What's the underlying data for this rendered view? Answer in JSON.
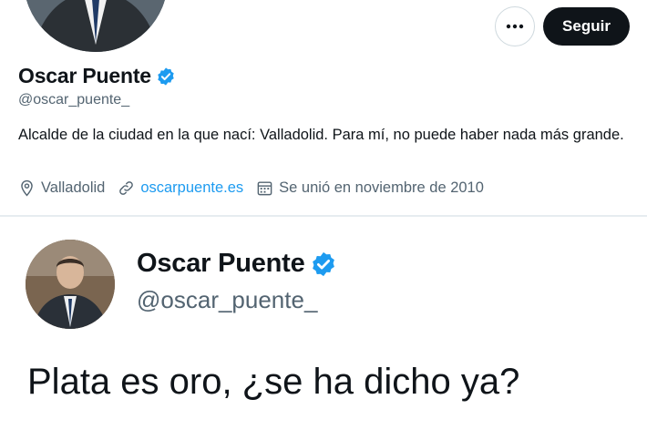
{
  "profile": {
    "name": "Oscar Puente",
    "handle": "@oscar_puente_",
    "bio": "Alcalde de la ciudad en la que nací: Valladolid. Para mí, no puede haber nada más grande.",
    "location": "Valladolid",
    "website": "oscarpuente.es",
    "joined": "Se unió en noviembre de 2010",
    "follow_label": "Seguir",
    "more_label": "···",
    "verified_color": "#1d9bf0"
  },
  "tweet": {
    "name": "Oscar Puente",
    "handle": "@oscar_puente_",
    "text": "Plata es oro, ¿se ha dicho ya?"
  },
  "icons": {
    "more": "more-options-icon",
    "verified": "verified-badge-icon",
    "location": "location-pin-icon",
    "link": "link-icon",
    "calendar": "calendar-icon"
  },
  "colors": {
    "primary_text": "#0f1419",
    "secondary_text": "#536471",
    "link": "#1d9bf0",
    "button_dark": "#0f1419"
  }
}
